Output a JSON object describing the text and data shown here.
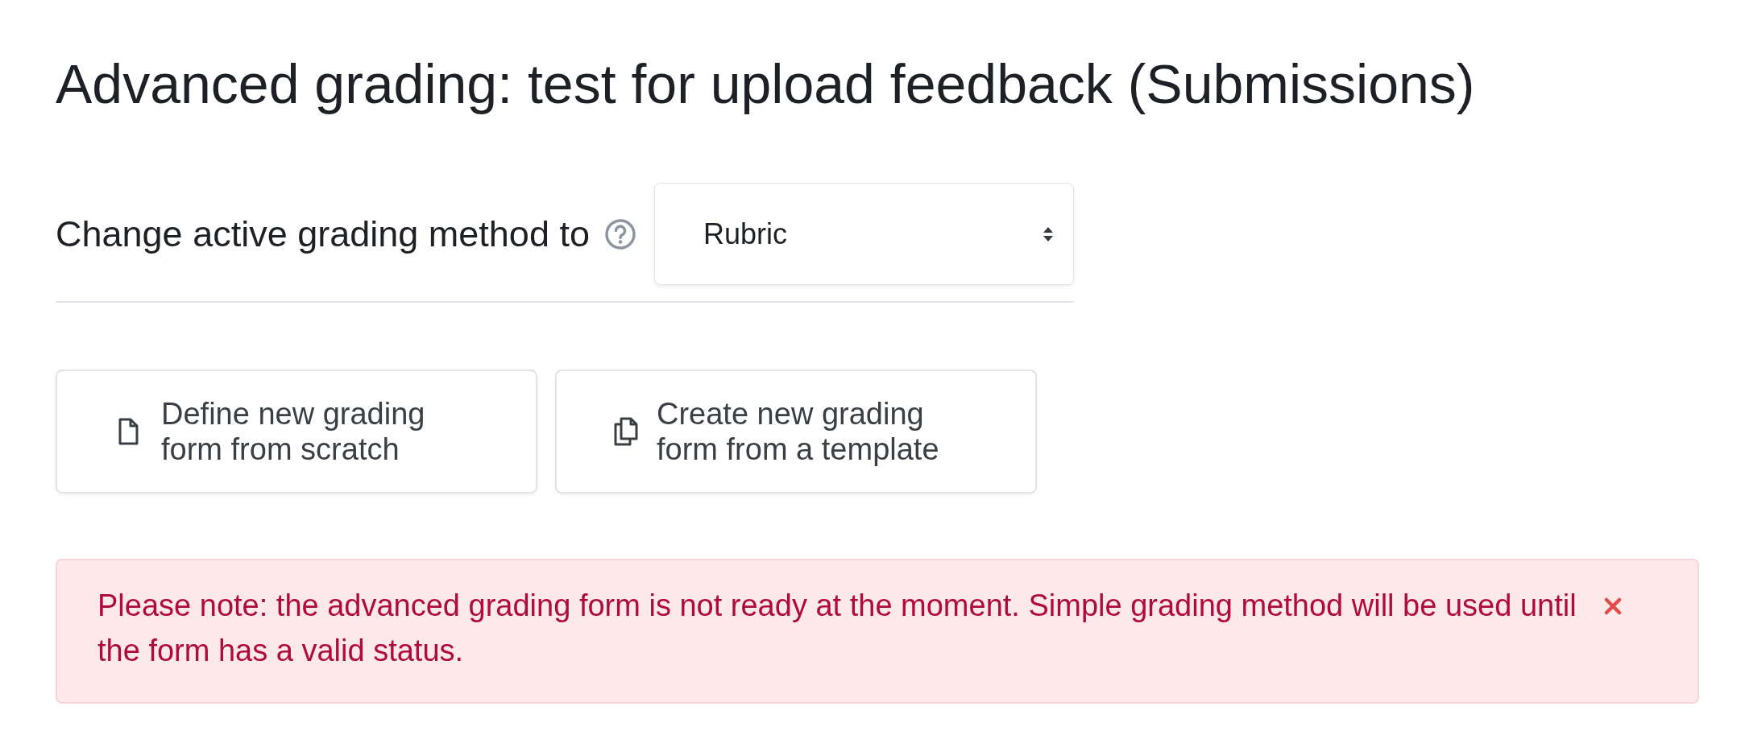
{
  "page_title": "Advanced grading: test for upload feedback (Submissions)",
  "method": {
    "label": "Change active grading method to",
    "value": "Rubric"
  },
  "actions": [
    {
      "kind": "blank",
      "lines": [
        "Define new grading",
        "form from scratch"
      ]
    },
    {
      "kind": "template",
      "lines": [
        "Create new grading",
        "form from a template"
      ]
    }
  ],
  "alert": {
    "text": "Please note: the advanced grading form is not ready at the moment. Simple grading method will be used until the form has a valid status."
  }
}
